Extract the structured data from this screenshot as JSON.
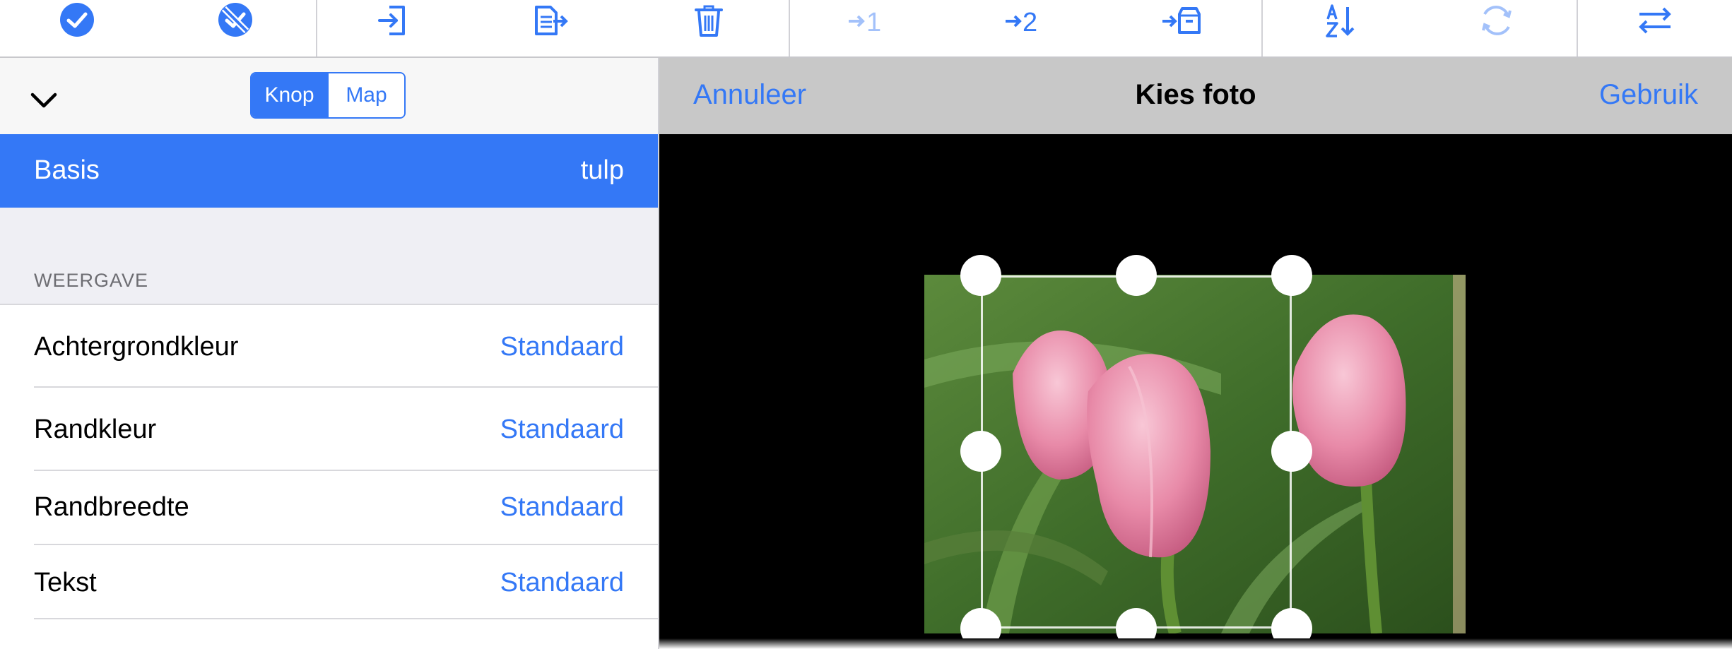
{
  "toolbar": {
    "buttons": [
      {
        "icon": "checkmark-circle-icon"
      },
      {
        "icon": "deselect-circle-icon"
      },
      {
        "icon": "import-icon"
      },
      {
        "icon": "export-list-icon"
      },
      {
        "icon": "trash-icon"
      },
      {
        "icon": "move-to-1-icon",
        "label": "1"
      },
      {
        "icon": "move-to-2-icon",
        "label": "2"
      },
      {
        "icon": "move-to-archive-icon"
      },
      {
        "icon": "sort-az-icon"
      },
      {
        "icon": "refresh-icon"
      },
      {
        "icon": "swap-icon"
      }
    ],
    "accent": "#3478f6"
  },
  "left_panel": {
    "segmented": {
      "options": [
        "Knop",
        "Map"
      ],
      "selected": "Knop"
    },
    "selected_row": {
      "label": "Basis",
      "value": "tulp"
    },
    "section_title": "WEERGAVE",
    "rows": [
      {
        "label": "Achtergrondkleur",
        "value": "Standaard"
      },
      {
        "label": "Randkleur",
        "value": "Standaard"
      },
      {
        "label": "Randbreedte",
        "value": "Standaard"
      },
      {
        "label": "Tekst",
        "value": "Standaard"
      }
    ]
  },
  "photo_picker": {
    "cancel_label": "Annuleer",
    "title": "Kies foto",
    "use_label": "Gebruik"
  }
}
